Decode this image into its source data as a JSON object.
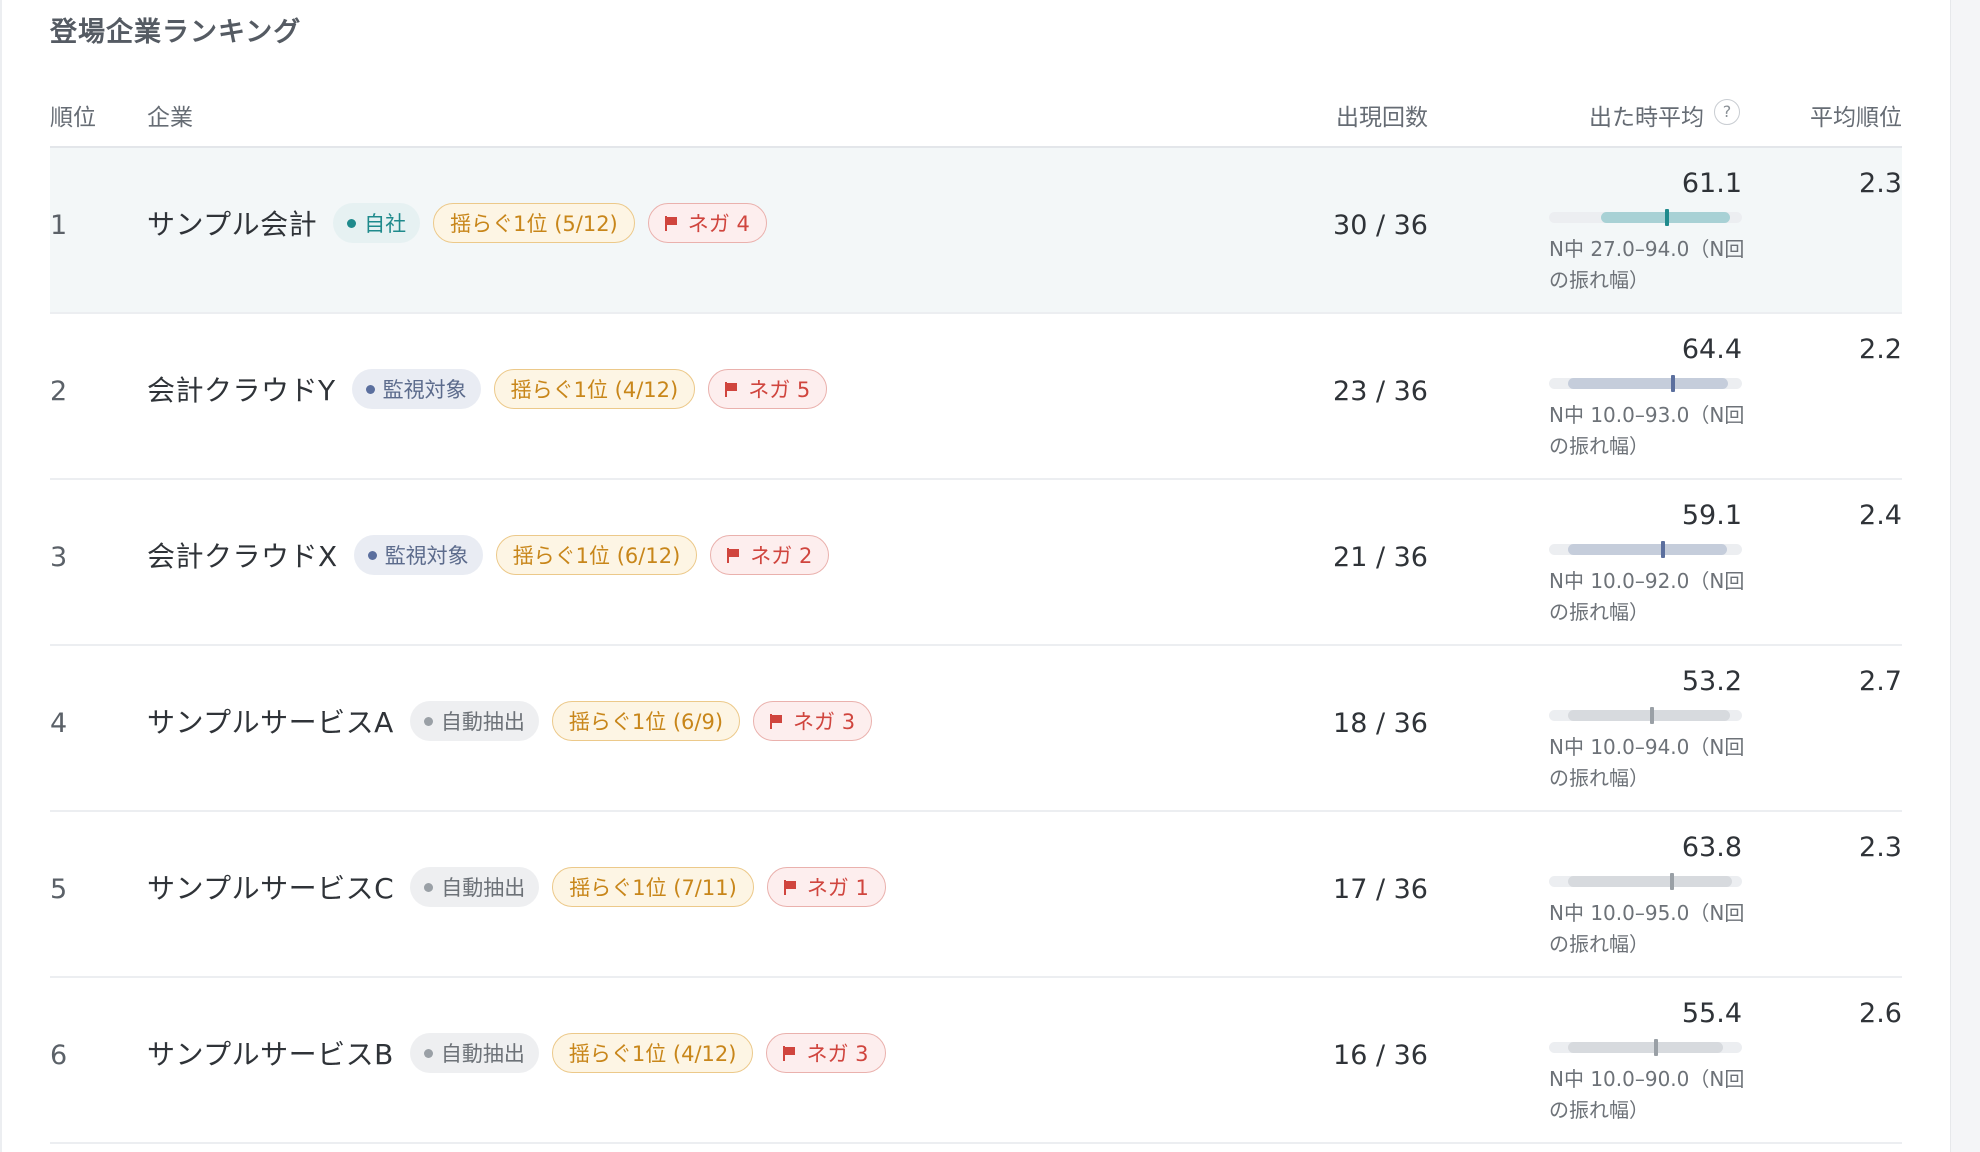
{
  "title": "登場企業ランキング",
  "columns": {
    "rank": "順位",
    "company": "企業",
    "count": "出現回数",
    "avg_when_shown": "出た時平均",
    "help": "?",
    "avg_rank": "平均順位"
  },
  "colors": {
    "own": "#1f8a8c",
    "own_bar": "#a8d1d5",
    "watch": "#5b6f9e",
    "watch_bar": "#c5cddb",
    "auto": "#9aa0a6",
    "auto_bar": "#d7dade",
    "sway": "#c8861a",
    "negative": "#d0453e"
  },
  "rows": [
    {
      "rank": "1",
      "name": "サンプル会計",
      "type": "own",
      "type_label": "自社",
      "sway": "揺らぐ1位 (5/12)",
      "neg": "ネガ 4",
      "count": "30 / 36",
      "avg": "61.1",
      "avg_value": 61.1,
      "range_min": 27.0,
      "range_max": 94.0,
      "range_note": "N中 27.0–94.0（N回の振れ幅）",
      "avg_rank": "2.3"
    },
    {
      "rank": "2",
      "name": "会計クラウドY",
      "type": "watch",
      "type_label": "監視対象",
      "sway": "揺らぐ1位 (4/12)",
      "neg": "ネガ 5",
      "count": "23 / 36",
      "avg": "64.4",
      "avg_value": 64.4,
      "range_min": 10.0,
      "range_max": 93.0,
      "range_note": "N中 10.0–93.0（N回の振れ幅）",
      "avg_rank": "2.2"
    },
    {
      "rank": "3",
      "name": "会計クラウドX",
      "type": "watch",
      "type_label": "監視対象",
      "sway": "揺らぐ1位 (6/12)",
      "neg": "ネガ 2",
      "count": "21 / 36",
      "avg": "59.1",
      "avg_value": 59.1,
      "range_min": 10.0,
      "range_max": 92.0,
      "range_note": "N中 10.0–92.0（N回の振れ幅）",
      "avg_rank": "2.4"
    },
    {
      "rank": "4",
      "name": "サンプルサービスA",
      "type": "auto",
      "type_label": "自動抽出",
      "sway": "揺らぐ1位 (6/9)",
      "neg": "ネガ 3",
      "count": "18 / 36",
      "avg": "53.2",
      "avg_value": 53.2,
      "range_min": 10.0,
      "range_max": 94.0,
      "range_note": "N中 10.0–94.0（N回の振れ幅）",
      "avg_rank": "2.7"
    },
    {
      "rank": "5",
      "name": "サンプルサービスC",
      "type": "auto",
      "type_label": "自動抽出",
      "sway": "揺らぐ1位 (7/11)",
      "neg": "ネガ 1",
      "count": "17 / 36",
      "avg": "63.8",
      "avg_value": 63.8,
      "range_min": 10.0,
      "range_max": 95.0,
      "range_note": "N中 10.0–95.0（N回の振れ幅）",
      "avg_rank": "2.3"
    },
    {
      "rank": "6",
      "name": "サンプルサービスB",
      "type": "auto",
      "type_label": "自動抽出",
      "sway": "揺らぐ1位 (4/12)",
      "neg": "ネガ 3",
      "count": "16 / 36",
      "avg": "55.4",
      "avg_value": 55.4,
      "range_min": 10.0,
      "range_max": 90.0,
      "range_note": "N中 10.0–90.0（N回の振れ幅）",
      "avg_rank": "2.6"
    }
  ]
}
